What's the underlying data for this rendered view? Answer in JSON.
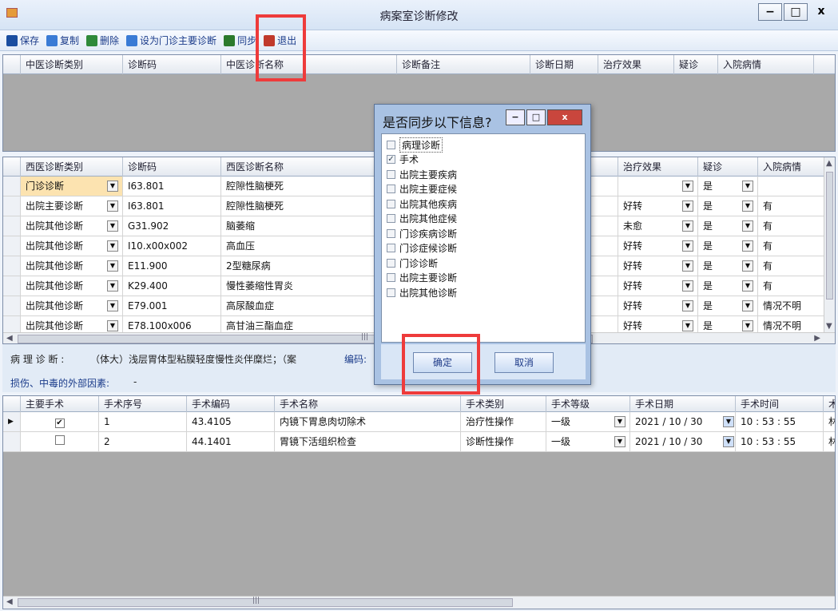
{
  "window": {
    "title": "病案室诊断修改",
    "min": "−",
    "max": "□",
    "close": "x"
  },
  "toolbar": [
    {
      "label": "保存",
      "icon": "save-icon",
      "color": "#1b4ea0"
    },
    {
      "label": "复制",
      "icon": "copy-icon",
      "color": "#3a7bd5"
    },
    {
      "label": "删除",
      "icon": "delete-icon",
      "color": "#2f8a3a"
    },
    {
      "label": "设为门诊主要诊断",
      "icon": "set-primary-icon",
      "color": "#3a7bd5"
    },
    {
      "label": "同步",
      "icon": "sync-icon",
      "color": "#2c7a2c"
    },
    {
      "label": "退出",
      "icon": "exit-icon",
      "color": "#c0392b"
    }
  ],
  "tcm_grid": {
    "headers": [
      "中医诊断类别",
      "诊断码",
      "中医诊断名称",
      "诊断备注",
      "诊断日期",
      "治疗效果",
      "疑诊",
      "入院病情"
    ]
  },
  "wm_grid": {
    "headers": [
      "西医诊断类别",
      "诊断码",
      "西医诊断名称",
      "治疗效果",
      "疑诊",
      "入院病情"
    ],
    "rows": [
      {
        "type": "门诊诊断",
        "code": "I63.801",
        "name": "腔隙性脑梗死",
        "effect": "",
        "suspect": "是",
        "admit": ""
      },
      {
        "type": "出院主要诊断",
        "code": "I63.801",
        "name": "腔隙性脑梗死",
        "effect": "好转",
        "suspect": "是",
        "admit": "有"
      },
      {
        "type": "出院其他诊断",
        "code": "G31.902",
        "name": "脑萎缩",
        "effect": "未愈",
        "suspect": "是",
        "admit": "有"
      },
      {
        "type": "出院其他诊断",
        "code": "I10.x00x002",
        "name": "高血压",
        "effect": "好转",
        "suspect": "是",
        "admit": "有"
      },
      {
        "type": "出院其他诊断",
        "code": "E11.900",
        "name": "2型糖尿病",
        "effect": "好转",
        "suspect": "是",
        "admit": "有"
      },
      {
        "type": "出院其他诊断",
        "code": "K29.400",
        "name": "慢性萎缩性胃炎",
        "effect": "好转",
        "suspect": "是",
        "admit": "有"
      },
      {
        "type": "出院其他诊断",
        "code": "E79.001",
        "name": "高尿酸血症",
        "effect": "好转",
        "suspect": "是",
        "admit": "情况不明"
      },
      {
        "type": "出院其他诊断",
        "code": "E78.100x006",
        "name": "高甘油三酯血症",
        "effect": "好转",
        "suspect": "是",
        "admit": "情况不明"
      }
    ]
  },
  "info": {
    "pathology_label": "病 理 诊 断 :",
    "pathology_value": "（体大）浅层胃体型粘膜轻度慢性炎伴糜烂；（案",
    "code_label": "编码:",
    "injury_label": "损伤、中毒的外部因素:",
    "injury_value": "-"
  },
  "op_grid": {
    "headers": [
      "主要手术",
      "手术序号",
      "手术编码",
      "手术名称",
      "手术类别",
      "手术等级",
      "手术日期",
      "手术时间",
      "术"
    ],
    "rows": [
      {
        "main": true,
        "seq": "1",
        "code": "43.4105",
        "name": "内镜下胃息肉切除术",
        "category": "治疗性操作",
        "level": "一级",
        "date": "2021 / 10 / 30",
        "time": "10 : 53 : 55",
        "extra": "林"
      },
      {
        "main": false,
        "seq": "2",
        "code": "44.1401",
        "name": "胃镜下活组织检查",
        "category": "诊断性操作",
        "level": "一级",
        "date": "2021 / 10 / 30",
        "time": "10 : 53 : 55",
        "extra": "林"
      }
    ]
  },
  "dialog": {
    "title": "是否同步以下信息?",
    "items": [
      {
        "label": "病理诊断",
        "checked": false
      },
      {
        "label": "手术",
        "checked": true
      },
      {
        "label": "出院主要疾病",
        "checked": false
      },
      {
        "label": "出院主要症候",
        "checked": false
      },
      {
        "label": "出院其他疾病",
        "checked": false
      },
      {
        "label": "出院其他症候",
        "checked": false
      },
      {
        "label": "门诊疾病诊断",
        "checked": false
      },
      {
        "label": "门诊症候诊断",
        "checked": false
      },
      {
        "label": "门诊诊断",
        "checked": false
      },
      {
        "label": "出院主要诊断",
        "checked": false
      },
      {
        "label": "出院其他诊断",
        "checked": false
      }
    ],
    "ok": "确定",
    "cancel": "取消"
  },
  "scroll": {
    "grip": "|||"
  }
}
